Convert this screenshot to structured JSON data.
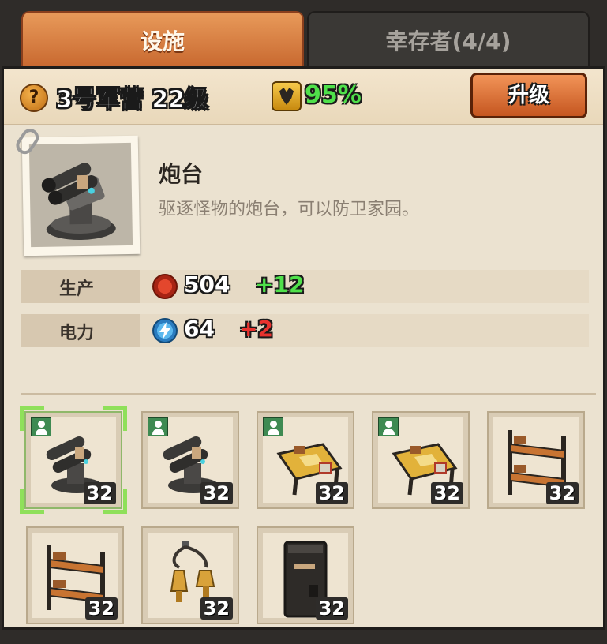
{
  "tabs": [
    {
      "label": "设施",
      "active": true
    },
    {
      "label": "幸存者(4/4)",
      "active": false
    }
  ],
  "header": {
    "help_icon": "question-mark-icon",
    "help_glyph": "?",
    "building_title": "3号军营 22级",
    "efficiency_icon": "efficiency-icon",
    "efficiency_value": "95%",
    "upgrade_label": "升级"
  },
  "facility": {
    "name": "炮台",
    "description": "驱逐怪物的炮台，可以防卫家园。",
    "image": "turret-icon"
  },
  "stats": [
    {
      "label": "生产",
      "icon": "bottle-cap-icon",
      "value": "504",
      "delta": "+12",
      "delta_color": "#4fe04a"
    },
    {
      "label": "电力",
      "icon": "lightning-icon",
      "value": "64",
      "delta": "+2",
      "delta_color": "#e8322e"
    }
  ],
  "slots": [
    {
      "item": "turret-icon",
      "level": "32",
      "has_survivor": true,
      "selected": true
    },
    {
      "item": "turret-icon",
      "level": "32",
      "has_survivor": true,
      "selected": false
    },
    {
      "item": "workbench-icon",
      "level": "32",
      "has_survivor": true,
      "selected": false
    },
    {
      "item": "workbench-icon",
      "level": "32",
      "has_survivor": true,
      "selected": false
    },
    {
      "item": "bunk-bed-icon",
      "level": "32",
      "has_survivor": false,
      "selected": false
    },
    {
      "item": "bunk-bed-icon",
      "level": "32",
      "has_survivor": false,
      "selected": false
    },
    {
      "item": "lantern-icon",
      "level": "32",
      "has_survivor": false,
      "selected": false
    },
    {
      "item": "generator-cabinet-icon",
      "level": "32",
      "has_survivor": false,
      "selected": false
    }
  ]
}
